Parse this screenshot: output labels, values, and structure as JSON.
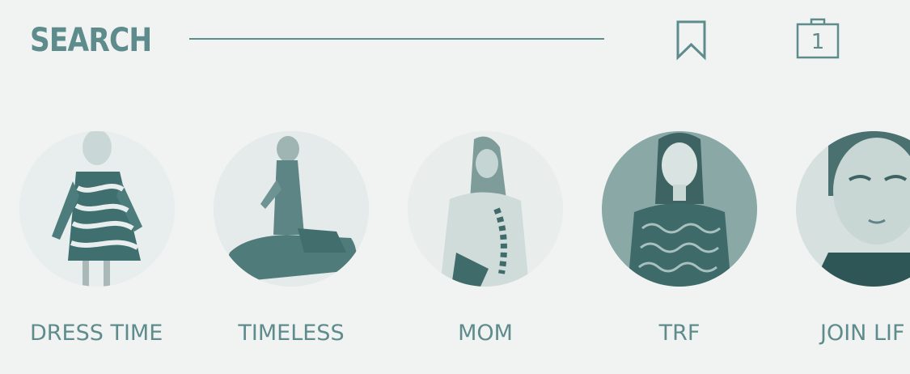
{
  "header": {
    "title": "SEARCH",
    "bag_count": "1"
  },
  "colors": {
    "accent": "#5e8c8c",
    "background": "#f1f3f2"
  },
  "icons": {
    "saved": "bookmark-icon",
    "cart": "shopping-bag-icon"
  },
  "collections": [
    {
      "label": "DRESS TIME"
    },
    {
      "label": "TIMELESS"
    },
    {
      "label": "MOM"
    },
    {
      "label": "TRF"
    },
    {
      "label": "JOIN LIF"
    }
  ]
}
